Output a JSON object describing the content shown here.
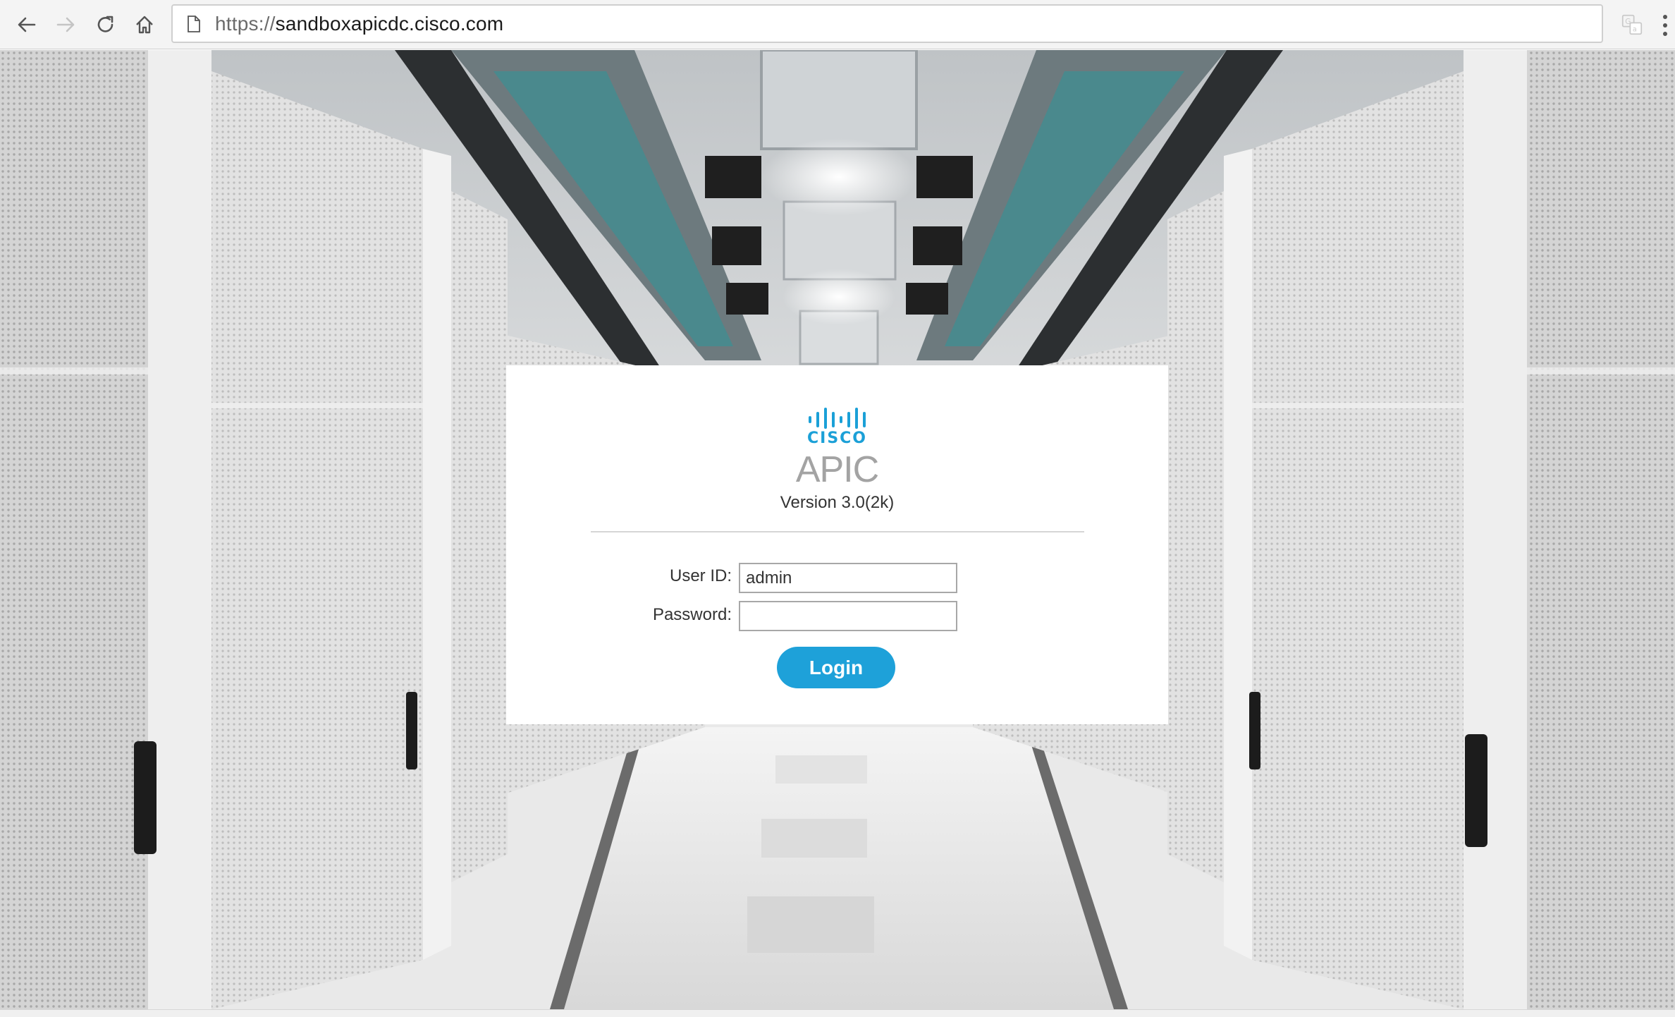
{
  "browser": {
    "url_protocol": "https://",
    "url_host": "sandboxapicdc.cisco.com",
    "back_icon": "arrow-left-icon",
    "forward_icon": "arrow-right-icon",
    "reload_icon": "reload-icon",
    "home_icon": "home-icon",
    "page_icon": "document-icon",
    "translate_icon": "translate-icon",
    "menu_icon": "vertical-dots-icon"
  },
  "login": {
    "brand": "CISCO",
    "app_name": "APIC",
    "version": "Version 3.0(2k)",
    "user_id_label": "User ID:",
    "user_id_value": "admin",
    "password_label": "Password:",
    "password_value": "",
    "login_button": "Login"
  },
  "colors": {
    "accent": "#1ea1d9",
    "brand_blue": "#1ba0d7",
    "title_gray": "#a3a3a3"
  }
}
